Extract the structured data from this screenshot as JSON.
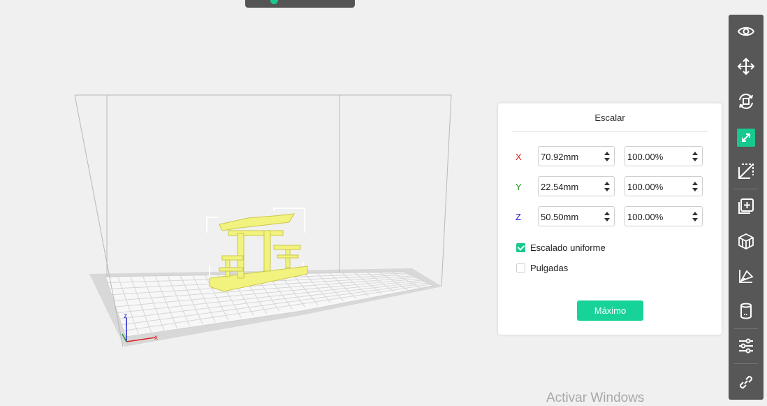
{
  "scale_panel": {
    "title": "Escalar",
    "rows": [
      {
        "axis": "X",
        "axis_color": "#e02020",
        "size": "70.92mm",
        "percent": "100.00%"
      },
      {
        "axis": "Y",
        "axis_color": "#1a9a1a",
        "size": "22.54mm",
        "percent": "100.00%"
      },
      {
        "axis": "Z",
        "axis_color": "#2020d0",
        "size": "50.50mm",
        "percent": "100.00%"
      }
    ],
    "uniform_scaling_label": "Escalado uniforme",
    "uniform_scaling_checked": true,
    "inches_label": "Pulgadas",
    "inches_checked": false,
    "max_button_label": "Máximo"
  },
  "viewport": {
    "axis_labels": {
      "x": "x",
      "z": "z"
    },
    "model_color": "#f2f27e"
  },
  "toolbar": {
    "tools": [
      "eye-icon",
      "move-icon",
      "rotate-icon",
      "scale-icon",
      "cut-icon",
      "add-model-icon",
      "support-icon",
      "flatten-icon",
      "cylinder-icon",
      "settings-sliders-icon",
      "link-icon"
    ],
    "active_tool": "scale-icon",
    "accent": "#17c98f"
  },
  "watermark": "Activar Windows"
}
